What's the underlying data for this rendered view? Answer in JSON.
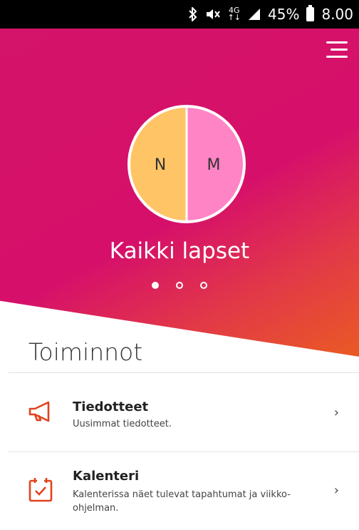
{
  "status_bar": {
    "network_top": "4G",
    "network_bottom": "↑↓",
    "battery_percent": "45%",
    "time": "8.00",
    "icons": [
      "bluetooth-icon",
      "mute-icon",
      "signal-icon",
      "battery-icon"
    ]
  },
  "hero": {
    "title": "Kaikki lapset",
    "avatars": [
      {
        "initial": "N",
        "color": "#ffc466"
      },
      {
        "initial": "M",
        "color": "#ff84c6"
      }
    ],
    "pager": {
      "count": 3,
      "active": 0
    },
    "colors": {
      "primary": "#d4136a",
      "secondary": "#ea5a24"
    }
  },
  "section": {
    "title": "Toiminnot"
  },
  "items": [
    {
      "title": "Tiedotteet",
      "subtitle": "Uusimmat tiedotteet.",
      "icon": "megaphone-icon"
    },
    {
      "title": "Kalenteri",
      "subtitle": "Kalenterissa näet tulevat tapahtumat ja viikko-ohjelman.",
      "icon": "calendar-check-icon"
    }
  ],
  "accent_color": "#e2421d"
}
